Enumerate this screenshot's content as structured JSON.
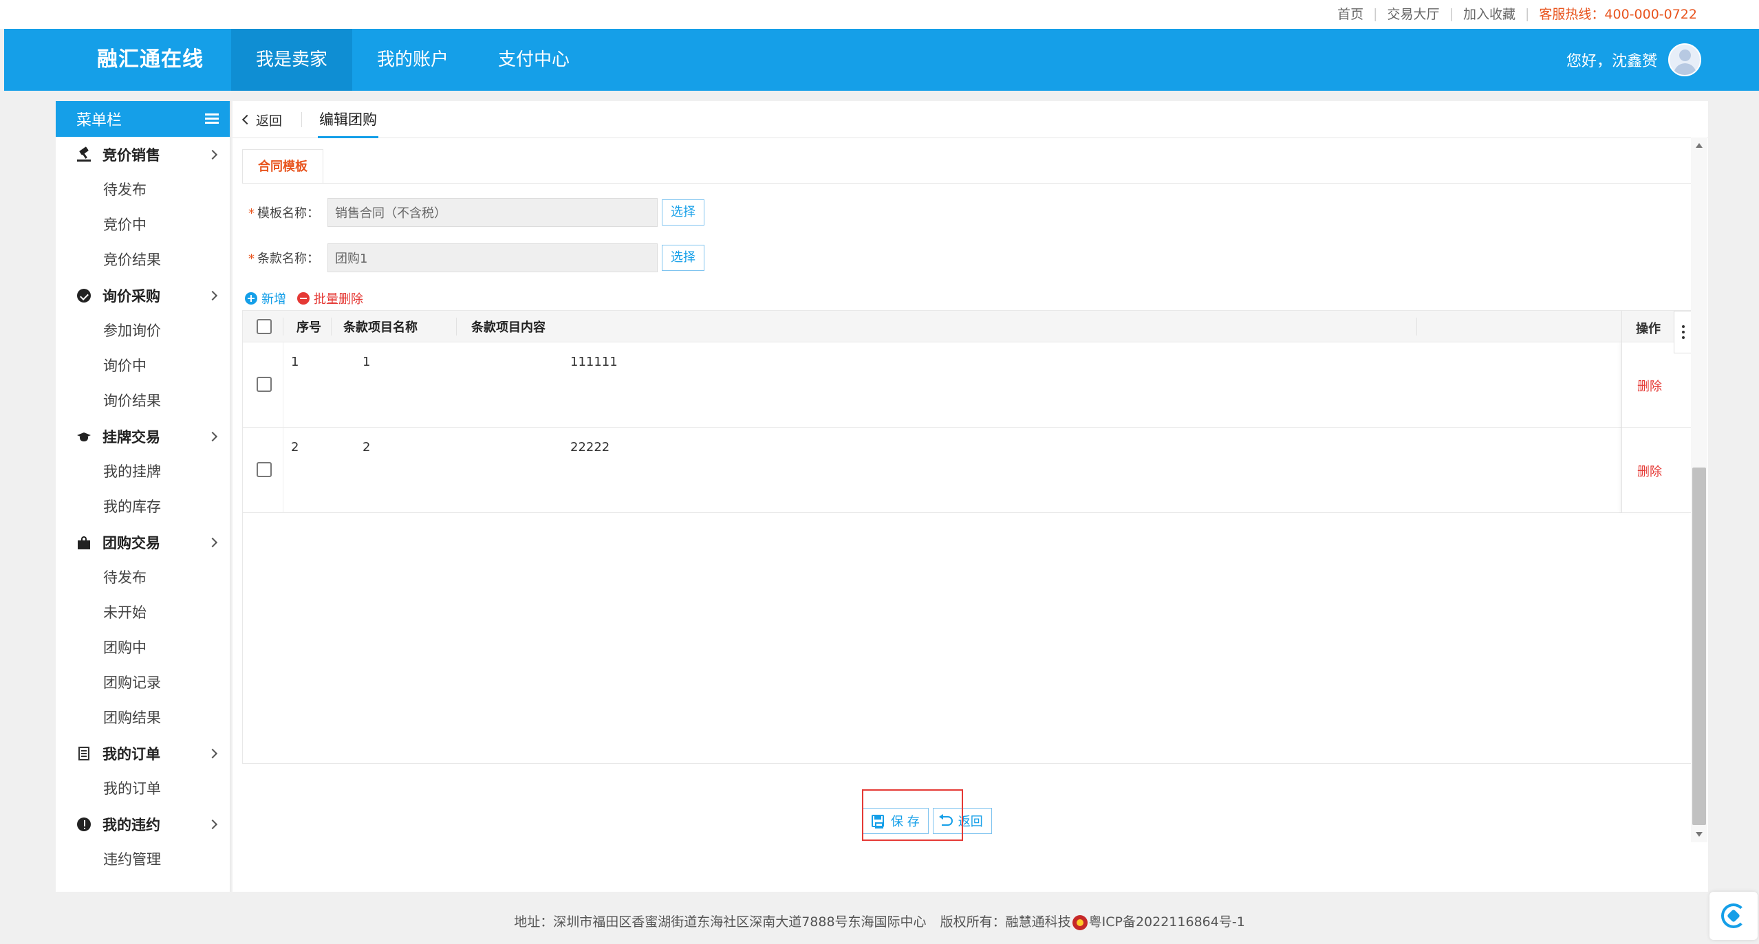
{
  "top_links": {
    "home": "首页",
    "hall": "交易大厅",
    "favorite": "加入收藏",
    "hotline": "客服热线：400-000-0722"
  },
  "header": {
    "logo": "融汇通在线",
    "nav": [
      "我是卖家",
      "我的账户",
      "支付中心"
    ],
    "greeting": "您好，沈鑫赟"
  },
  "sidebar": {
    "title": "菜单栏",
    "groups": [
      {
        "label": "竞价销售",
        "icon": "gavel-icon",
        "items": [
          "待发布",
          "竞价中",
          "竞价结果"
        ]
      },
      {
        "label": "询价采购",
        "icon": "check-circle-icon",
        "items": [
          "参加询价",
          "询价中",
          "询价结果"
        ]
      },
      {
        "label": "挂牌交易",
        "icon": "graduation-cap-icon",
        "items": [
          "我的挂牌",
          "我的库存"
        ]
      },
      {
        "label": "团购交易",
        "icon": "shopping-bag-icon",
        "items": [
          "待发布",
          "未开始",
          "团购中",
          "团购记录",
          "团购结果"
        ]
      },
      {
        "label": "我的订单",
        "icon": "document-icon",
        "items": [
          "我的订单"
        ]
      },
      {
        "label": "我的违约",
        "icon": "exclamation-circle-icon",
        "items": [
          "违约管理"
        ]
      }
    ]
  },
  "tabs": {
    "back": "返回",
    "current": "编辑团购"
  },
  "form": {
    "section_tab": "合同模板",
    "template_label": "模板名称：",
    "template_value": "销售合同（不含税）",
    "clause_label": "条款名称：",
    "clause_value": "团购1",
    "choose": "选择"
  },
  "toolbar": {
    "add": "新增",
    "batch_delete": "批量删除"
  },
  "table": {
    "headers": {
      "seq": "序号",
      "name": "条款项目名称",
      "content": "条款项目内容",
      "ops": "操作"
    },
    "rows": [
      {
        "seq": "1",
        "name": "1",
        "content": "111111",
        "op": "删除"
      },
      {
        "seq": "2",
        "name": "2",
        "content": "22222",
        "op": "删除"
      }
    ]
  },
  "actions": {
    "save": "保 存",
    "back": "返回"
  },
  "footer": {
    "address": "地址：深圳市福田区香蜜湖街道东海社区深南大道7888号东海国际中心",
    "copyright": "版权所有：融慧通科技",
    "icp": "粤ICP备2022116864号-1"
  },
  "colors": {
    "primary": "#159fe8",
    "accent": "#e8541e",
    "danger": "#e53935"
  }
}
